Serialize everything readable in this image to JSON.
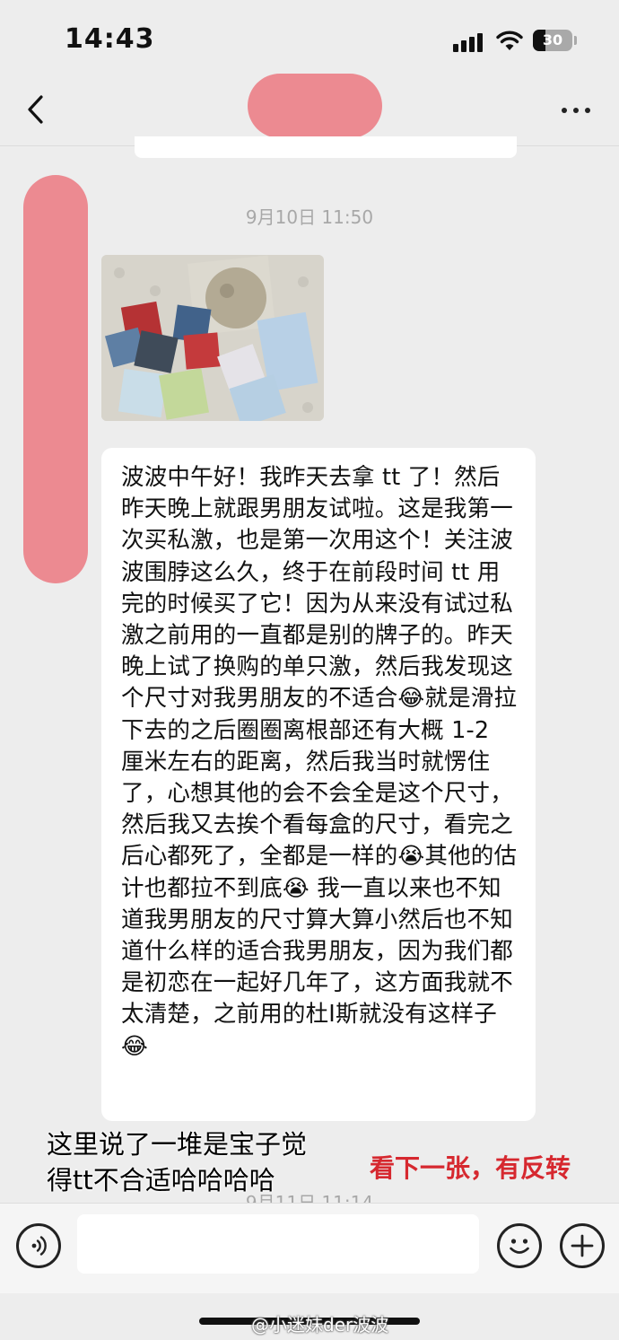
{
  "status_bar": {
    "time": "14:43",
    "battery": "30"
  },
  "nav": {
    "back_icon": "chevron-left-icon",
    "more_icon": "more-dots-icon"
  },
  "chat": {
    "timestamp_1": "9月10日 11:50",
    "message_text": "波波中午好！我昨天去拿 tt 了！然后昨天晚上就跟男朋友试啦。这是我第一次买私激，也是第一次用这个！关注波波围脖这么久，终于在前段时间 tt 用完的时候买了它！因为从来没有试过私激之前用的一直都是别的牌子的。昨天晚上试了换购的单只激，然后我发现这个尺寸对我男朋友的不适合😂就是滑拉下去的之后圈圈离根部还有大概 1-2 厘米左右的距离，然后我当时就愣住了，心想其他的会不会全是这个尺寸，然后我又去挨个看每盒的尺寸，看完之后心都死了，全都是一样的😭其他的估计也都拉不到底😭 我一直以来也不知道我男朋友的尺寸算大算小然后也不知道什么样的适合我男朋友，因为我们都是初恋在一起好几年了，这方面我就不太清楚，之前用的杜I斯就没有这样子😂",
    "timestamp_2": "9月11日 11:14"
  },
  "overlay": {
    "caption_line1": "这里说了一堆是宝子觉",
    "caption_line2": "得tt不合适哈哈哈哈",
    "red_caption": "看下一张，有反转"
  },
  "input_bar": {
    "placeholder": ""
  },
  "watermark": "@小迷妹der波波",
  "colors": {
    "background": "#ededed",
    "blur_pink": "#ec8a91",
    "red_text": "#d6282f"
  }
}
